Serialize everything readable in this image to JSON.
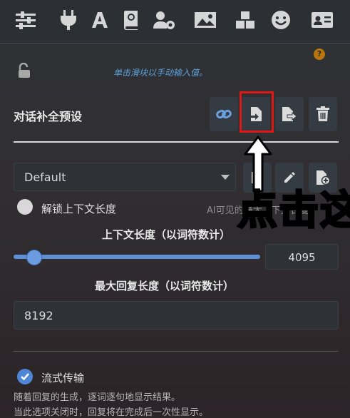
{
  "topbar": {
    "icons": [
      "sliders-icon",
      "plug-icon",
      "font-icon",
      "book-icon",
      "user-gear-icon",
      "image-icon",
      "cubes-icon",
      "smile-icon",
      "id-card-icon"
    ]
  },
  "hint": {
    "badge": "?",
    "text": "单击滑块以手动输入值。"
  },
  "presets": {
    "title": "对话补全预设"
  },
  "preset_select": {
    "value": "Default"
  },
  "overlay": {
    "text": "点击这"
  },
  "unlock_context": {
    "label": "解锁上下文长度",
    "hint": "AI可见的最大上下文长度"
  },
  "context_length": {
    "title": "上下文长度（以词符数计）",
    "value": "4095",
    "fraction": 0.07
  },
  "max_response": {
    "title": "最大回复长度（以词符数计）",
    "value": "8192"
  },
  "streaming": {
    "label": "流式传输",
    "desc1": "随着回复的生成，逐词逐句地显示结果。",
    "desc2": "当此选项关闭时，回复将在完成后一次性显示。"
  },
  "colors": {
    "accent": "#4f86d6",
    "highlight": "#e01717",
    "hint": "#5aa0d8"
  }
}
